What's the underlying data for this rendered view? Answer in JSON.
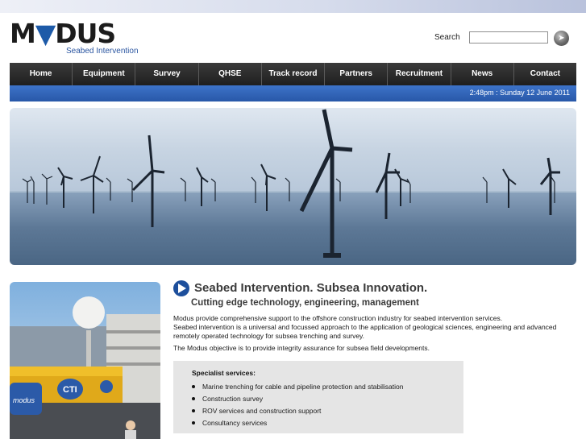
{
  "brand": {
    "logo_text": "MODUS",
    "tagline": "Seabed Intervention",
    "logo_color": "#1d5aa8"
  },
  "search": {
    "label": "Search",
    "value": "",
    "placeholder": "",
    "button_icon": "search-go-icon"
  },
  "nav": {
    "items": [
      {
        "label": "Home"
      },
      {
        "label": "Equipment"
      },
      {
        "label": "Survey"
      },
      {
        "label": "QHSE"
      },
      {
        "label": "Track record"
      },
      {
        "label": "Partners"
      },
      {
        "label": "Recruitment"
      },
      {
        "label": "News"
      },
      {
        "label": "Contact"
      }
    ]
  },
  "date_bar": {
    "text": "2:48pm : Sunday 12 June 2011",
    "color": "#2f62b4"
  },
  "hero": {
    "image": "offshore wind farm"
  },
  "content": {
    "headline": "Seabed Intervention. Subsea Innovation.",
    "subheadline": "Cutting edge technology, engineering, management",
    "paragraph_1_line_1": "Modus provide comprehensive support to the offshore construction industry for seabed intervention services.",
    "paragraph_1_line_2": "Seabed intervention is a universal and focussed approach to the application of geological sciences, engineering and advanced remotely operated technology for subsea trenching and survey.",
    "paragraph_2": "The Modus objective is to provide integrity assurance for subsea field developments.",
    "services": {
      "title": "Specialist services:",
      "items": [
        "Marine trenching for cable and pipeline protection and stabilisation",
        "Construction survey",
        "ROV services and construction support",
        "Consultancy services"
      ]
    }
  },
  "photo": {
    "image": "subsea vehicle on vessel deck",
    "badge_1": "modus",
    "badge_2": "CTI"
  }
}
